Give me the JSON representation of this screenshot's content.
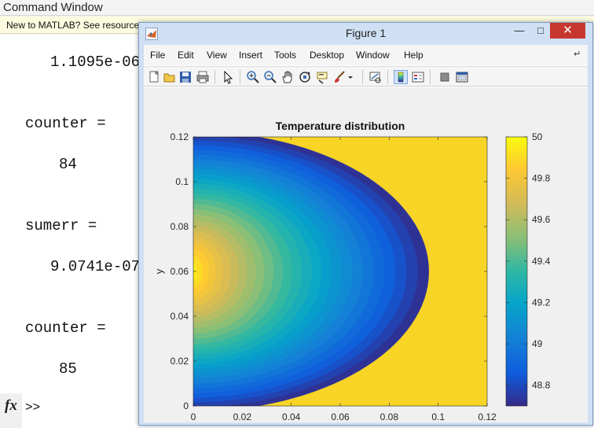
{
  "command_window": {
    "title": "Command Window",
    "banner": "New to MATLAB? See resources",
    "lines": [
      {
        "text": "1.1095e-06"
      },
      {
        "text": "counter ="
      },
      {
        "text": "84"
      },
      {
        "text": "sumerr ="
      },
      {
        "text": "9.0741e-07"
      },
      {
        "text": "counter ="
      },
      {
        "text": "85"
      }
    ],
    "prompt": ">>",
    "fx_icon": "fx"
  },
  "figure": {
    "title": "Figure 1",
    "window_buttons": {
      "minimize": "—",
      "maximize": "□",
      "close": "✕"
    },
    "menu": [
      "File",
      "Edit",
      "View",
      "Insert",
      "Tools",
      "Desktop",
      "Window",
      "Help"
    ],
    "menu_corner_icon": "↵",
    "toolbar_icons": [
      "new-figure-icon",
      "open-file-icon",
      "save-icon",
      "print-icon",
      "edit-plot-icon",
      "zoom-in-icon",
      "zoom-out-icon",
      "pan-icon",
      "rotate-3d-icon",
      "data-cursor-icon",
      "brush-icon",
      "brush-dropdown-icon",
      "link-plot-icon",
      "insert-colorbar-icon",
      "insert-legend-icon",
      "hide-plot-tools-icon",
      "show-plot-tools-icon"
    ]
  },
  "chart_data": {
    "type": "heatmap",
    "title": "Temperature distribution",
    "xlabel": "x",
    "ylabel": "y",
    "xlim": [
      0,
      0.12
    ],
    "ylim": [
      0,
      0.12
    ],
    "x_ticks": [
      "0",
      "0.02",
      "0.04",
      "0.06",
      "0.08",
      "0.1",
      "0.12"
    ],
    "y_ticks": [
      "0",
      "0.02",
      "0.04",
      "0.06",
      "0.08",
      "0.1",
      "0.12"
    ],
    "colorbar": {
      "range": [
        48.7,
        50
      ],
      "ticks": [
        "48.8",
        "49",
        "49.2",
        "49.4",
        "49.6",
        "49.8",
        "50"
      ],
      "colormap": "parula"
    },
    "field_summary": {
      "min_value": 48.7,
      "min_location": [
        0,
        0.06
      ],
      "max_value": 50
    }
  },
  "colors": {
    "figure_frame": "#cfe0f4",
    "close_button": "#c7372f",
    "banner": "#fdfbe0"
  }
}
